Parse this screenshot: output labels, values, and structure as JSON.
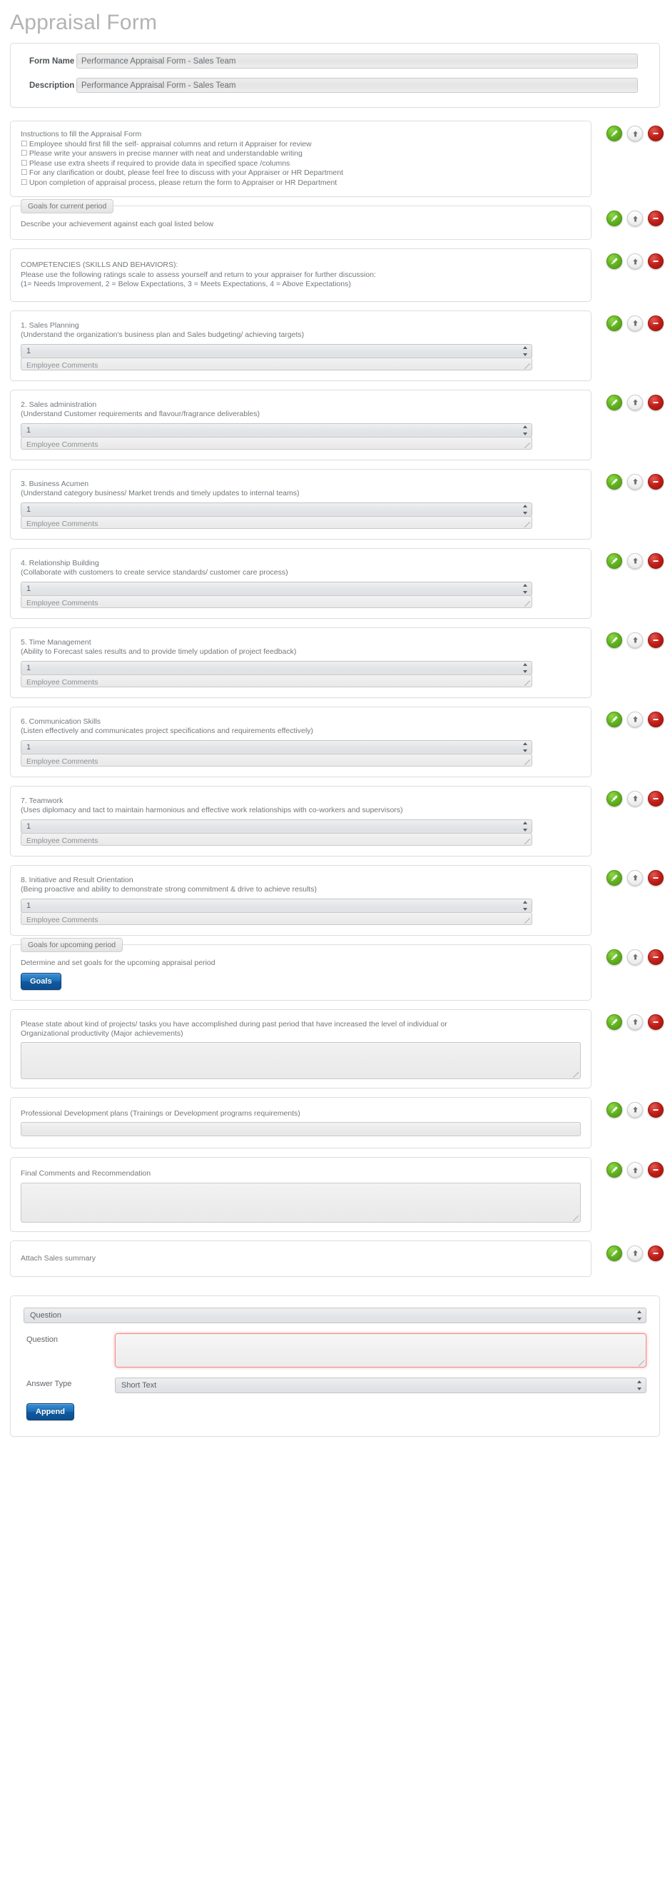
{
  "page": {
    "title": "Appraisal Form"
  },
  "header": {
    "form_name_label": "Form Name",
    "form_name_value": "Performance Appraisal Form - Sales Team",
    "description_label": "Description",
    "description_value": "Performance Appraisal Form - Sales Team"
  },
  "actions": {
    "edit_icon": "pencil-icon",
    "move_up_icon": "arrow-up-icon",
    "remove_icon": "minus-icon"
  },
  "instructions": {
    "heading": "Instructions to fill the Appraisal Form",
    "items": [
      "Employee should first fill the self- appraisal columns and return it Appraiser for review",
      "Please write your answers in precise manner with neat and understandable writing",
      "Please use extra sheets if required to provide data in specified space /columns",
      "For any clarification or doubt, please feel free to discuss with your Appraiser or HR Department",
      "Upon completion of appraisal process, please return the form to Appraiser or HR Department"
    ]
  },
  "goals_current": {
    "legend": "Goals for current period",
    "body": "Describe your achievement against each goal listed below"
  },
  "competencies_intro": {
    "line1": "COMPETENCIES (SKILLS AND BEHAVIORS):",
    "line2": "Please use the following ratings scale to assess yourself and return to your appraiser for further discussion:",
    "line3": "(1= Needs Improvement, 2 = Below Expectations, 3 = Meets Expectations, 4 = Above Expectations)"
  },
  "competencies": [
    {
      "title": "1. Sales Planning",
      "subtitle": "(Understand the organization's business plan and Sales budgeting/ achieving targets)",
      "rating_value": "1",
      "comments_placeholder": "Employee Comments"
    },
    {
      "title": "2. Sales administration",
      "subtitle": "(Understand Customer requirements and flavour/fragrance deliverables)",
      "rating_value": "1",
      "comments_placeholder": "Employee Comments"
    },
    {
      "title": "3. Business Acumen",
      "subtitle": "(Understand category business/ Market trends and timely updates to internal teams)",
      "rating_value": "1",
      "comments_placeholder": "Employee Comments"
    },
    {
      "title": "4. Relationship Building",
      "subtitle": "(Collaborate with customers to create service standards/ customer care process)",
      "rating_value": "1",
      "comments_placeholder": "Employee Comments"
    },
    {
      "title": "5. Time Management",
      "subtitle": "(Ability to Forecast sales results and to provide timely updation of project feedback)",
      "rating_value": "1",
      "comments_placeholder": "Employee Comments"
    },
    {
      "title": "6. Communication Skills",
      "subtitle": "(Listen effectively and communicates project specifications and requirements effectively)",
      "rating_value": "1",
      "comments_placeholder": "Employee Comments"
    },
    {
      "title": "7. Teamwork",
      "subtitle": "(Uses diplomacy and tact to maintain harmonious and effective work relationships with co-workers and supervisors)",
      "rating_value": "1",
      "comments_placeholder": "Employee Comments"
    },
    {
      "title": "8. Initiative and Result Orientation",
      "subtitle": "(Being proactive and ability to demonstrate strong commitment & drive to achieve results)",
      "rating_value": "1",
      "comments_placeholder": "Employee Comments"
    }
  ],
  "goals_upcoming": {
    "legend": "Goals for upcoming period",
    "body": "Determine and set goals for the upcoming appraisal period",
    "button_label": "Goals"
  },
  "achievements": {
    "line1": "Please state about kind of projects/ tasks you have accomplished during past period that have increased the level of individual or",
    "line2": "Organizational productivity (Major achievements)",
    "value": ""
  },
  "professional_development": {
    "label": "Professional Development plans (Trainings or Development programs requirements)",
    "value": ""
  },
  "final_comments": {
    "label": "Final Comments and Recommendation",
    "value": ""
  },
  "attachment": {
    "label": "Attach Sales summary"
  },
  "builder": {
    "type_select_value": "Question",
    "question_label": "Question",
    "question_value": "",
    "answer_type_label": "Answer Type",
    "answer_type_value": "Short Text",
    "append_label": "Append"
  },
  "colors": {
    "edit_green": "#63b522",
    "remove_red": "#c21f18",
    "button_blue": "#1a6fba",
    "required_outline": "#f08b8b",
    "title_gray": "#b3b3b3"
  }
}
